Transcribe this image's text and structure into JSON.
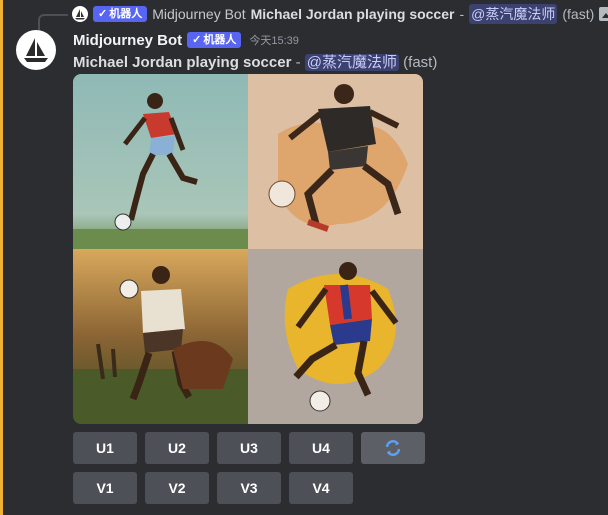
{
  "reply": {
    "badge_label": "机器人",
    "author": "Midjourney Bot",
    "prompt": "Michael Jordan playing soccer",
    "separator": " - ",
    "mention": "@蒸汽魔法师",
    "speed": "(fast)",
    "attachment_icon": "image-icon"
  },
  "message": {
    "username": "Midjourney Bot",
    "badge_label": "机器人",
    "timestamp": "今天15:39",
    "prompt": "Michael Jordan playing soccer",
    "separator": " - ",
    "mention": "@蒸汽魔法师",
    "speed": "(fast)"
  },
  "upscale_buttons": [
    "U1",
    "U2",
    "U3",
    "U4"
  ],
  "reroll_icon": "refresh-icon",
  "variation_buttons": [
    "V1",
    "V2",
    "V3",
    "V4"
  ],
  "colors": {
    "accent": "#f0b232",
    "badge": "#5865f2",
    "mention_bg": "#3c4270",
    "background": "#2b2d31",
    "button": "#4e5058"
  }
}
